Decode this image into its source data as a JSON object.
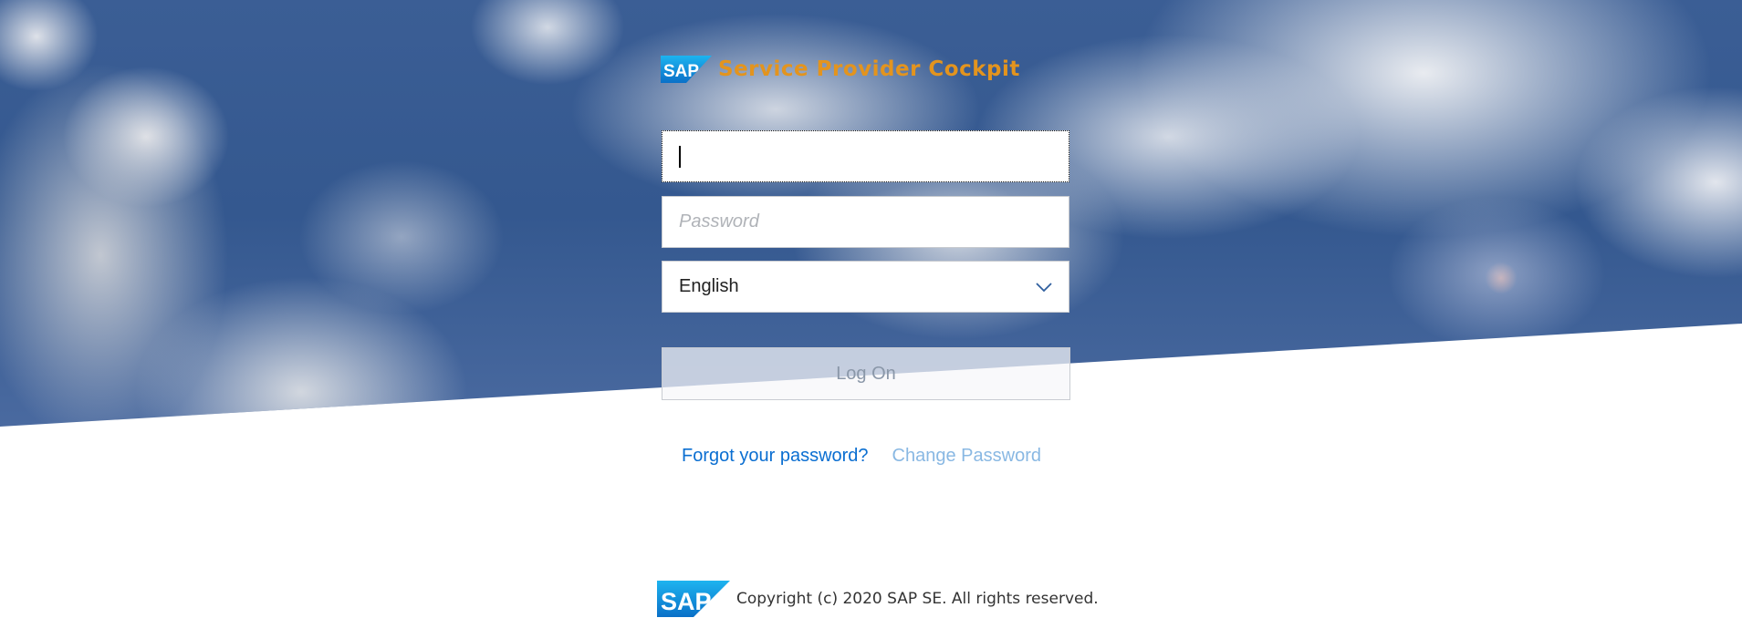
{
  "brand": {
    "logo_text": "SAP",
    "title": "Service Provider Cockpit"
  },
  "login": {
    "username_value": "",
    "password_placeholder": "Password",
    "language_selected": "English",
    "logon_label": "Log On"
  },
  "links": {
    "forgot_password": "Forgot your password?",
    "change_password": "Change Password"
  },
  "footer": {
    "logo_text": "SAP",
    "copyright": "Copyright (c) 2020 SAP SE. All rights reserved."
  },
  "colors": {
    "accent_title": "#e3941e",
    "link": "#0a6ed1",
    "link_disabled": "#89b8e3",
    "sap_blue": "#1a8cd8"
  },
  "icons": {
    "dropdown": "chevron-down-icon"
  }
}
